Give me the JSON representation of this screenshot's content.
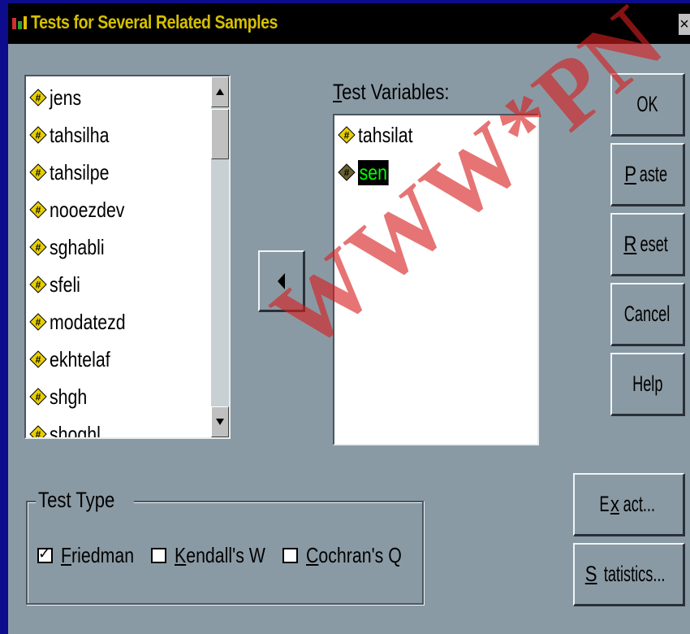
{
  "window": {
    "title": "Tests for Several Related Samples",
    "close_glyph": "×"
  },
  "source_list": {
    "items": [
      "jens",
      "tahsilha",
      "tahsilpe",
      "nooezdev",
      "sghabli",
      "sfeli",
      "modatezd",
      "ekhtelaf",
      "shgh",
      "shoghl"
    ],
    "scroll_up_icon": "triangle-up",
    "scroll_down_icon": "triangle-down"
  },
  "move_button": {
    "glyph": "◀",
    "icon": "left-arrow-icon"
  },
  "test_variables": {
    "label_mnemonic": "T",
    "label_rest": "est Variables:",
    "items": [
      {
        "name": "tahsilat",
        "selected": false
      },
      {
        "name": "sen",
        "selected": true
      }
    ],
    "selected_text_color": "#00ff00",
    "selected_bg_color": "#000000"
  },
  "buttons": {
    "ok": {
      "pre": "OK",
      "mnemonic": "",
      "post": ""
    },
    "paste": {
      "pre": "",
      "mnemonic": "P",
      "post": "aste"
    },
    "reset": {
      "pre": "",
      "mnemonic": "R",
      "post": "eset"
    },
    "cancel": {
      "pre": "Cancel",
      "mnemonic": "",
      "post": ""
    },
    "help": {
      "pre": "Help",
      "mnemonic": "",
      "post": ""
    },
    "exact": {
      "pre": "E",
      "mnemonic": "x",
      "post": "act..."
    },
    "statistics": {
      "pre": "",
      "mnemonic": "S",
      "post": "tatistics..."
    }
  },
  "test_type": {
    "title": "Test Type",
    "options": [
      {
        "mnemonic": "F",
        "rest": "riedman",
        "checked": true
      },
      {
        "mnemonic": "K",
        "rest": "endall's W",
        "checked": false
      },
      {
        "mnemonic": "C",
        "rest": "ochran's Q",
        "checked": false
      }
    ],
    "check_glyph": "✓"
  },
  "watermark": {
    "text": "WWW*PN"
  },
  "colors": {
    "desktop": "#0c0c8c",
    "dialog_face": "#8a9aa4",
    "titlebar": "#000000",
    "title_text": "#d4c000",
    "var_icon_fill": "#e8d000",
    "watermark": "#d71e1e"
  }
}
